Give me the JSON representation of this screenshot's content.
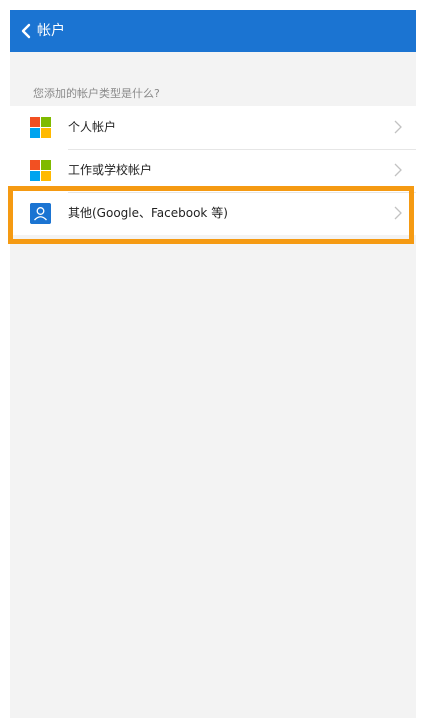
{
  "header": {
    "title": "帐户",
    "back_icon": "chevron-left-icon",
    "background": "#1b74d2"
  },
  "section": {
    "label": "您添加的帐户类型是什么?"
  },
  "accounts": [
    {
      "label": "个人帐户",
      "icon": "microsoft-logo-icon"
    },
    {
      "label": "工作或学校帐户",
      "icon": "microsoft-logo-icon"
    },
    {
      "label": "其他(Google、Facebook 等)",
      "icon": "person-icon"
    }
  ],
  "highlight": {
    "color": "#f59a12",
    "target": "accounts.2"
  },
  "colors": {
    "ms_red": "#f25022",
    "ms_green": "#7fba00",
    "ms_blue": "#00a4ef",
    "ms_yellow": "#ffb900"
  }
}
